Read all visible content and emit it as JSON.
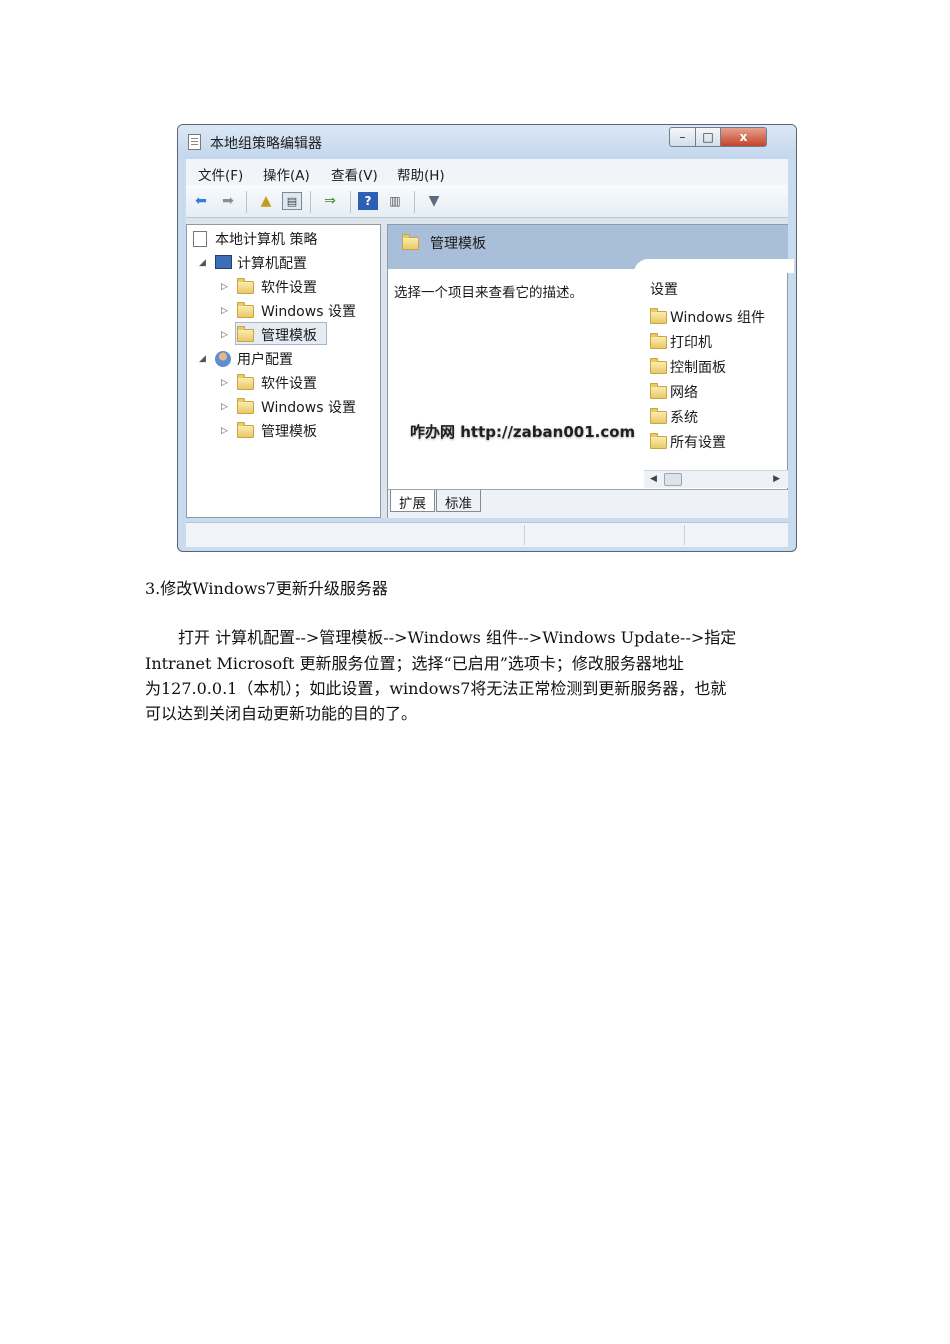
{
  "window": {
    "title": "本地组策略编辑器",
    "controls": {
      "minimize": "–",
      "maximize": "□",
      "close": "x"
    }
  },
  "menu": [
    "文件(F)",
    "操作(A)",
    "查看(V)",
    "帮助(H)"
  ],
  "toolbar_icons": [
    "back-arrow-icon",
    "forward-arrow-icon",
    "up-folder-icon",
    "show-hide-tree-icon",
    "export-list-icon",
    "help-icon",
    "properties-view-icon",
    "filter-icon"
  ],
  "tree": {
    "root": "本地计算机 策略",
    "computer_config": "计算机配置",
    "computer_children": [
      "软件设置",
      "Windows 设置",
      "管理模板"
    ],
    "user_config": "用户配置",
    "user_children": [
      "软件设置",
      "Windows 设置",
      "管理模板"
    ]
  },
  "right_pane": {
    "header": "管理模板",
    "description": "选择一个项目来查看它的描述。",
    "column_header": "设置",
    "items": [
      "Windows 组件",
      "打印机",
      "控制面板",
      "网络",
      "系统",
      "所有设置"
    ],
    "watermark": "咋办网 http://zaban001.com",
    "tabs": [
      "扩展",
      "标准"
    ]
  },
  "document": {
    "heading": "3.修改Windows7更新升级服务器",
    "paragraph_lines": [
      "打开 计算机配置-->管理模板-->Windows 组件-->Windows Update-->指定",
      "Intranet Microsoft 更新服务位置；选择“已启用”选项卡；修改服务器地址",
      "为127.0.0.1（本机）；如此设置，windows7将无法正常检测到更新服务器，也就",
      "可以达到关闭自动更新功能的目的了。"
    ]
  }
}
